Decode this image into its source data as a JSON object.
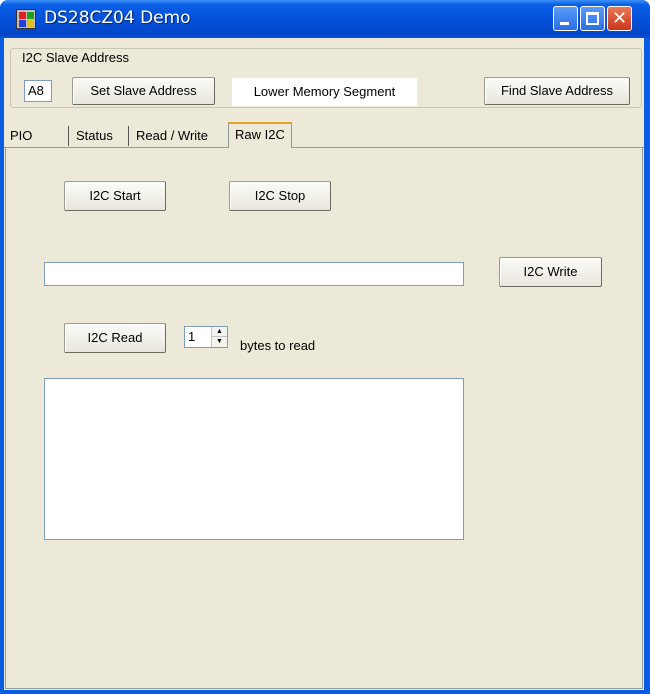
{
  "window": {
    "title": "DS28CZ04 Demo",
    "close_glyph": "✕"
  },
  "slave_address": {
    "group_label": "I2C Slave Address",
    "value": "A8",
    "set_button": "Set Slave Address",
    "segment_label": "Lower Memory Segment",
    "find_button": "Find Slave Address"
  },
  "tabs": [
    {
      "label": "PIO"
    },
    {
      "label": "Status"
    },
    {
      "label": "Read / Write"
    },
    {
      "label": "Raw I2C",
      "active": true
    }
  ],
  "raw_i2c": {
    "start_button": "I2C Start",
    "stop_button": "I2C Stop",
    "write_value": "",
    "write_button": "I2C Write",
    "read_button": "I2C Read",
    "bytes_value": "1",
    "spin_up_glyph": "▲",
    "spin_down_glyph": "▼",
    "bytes_label": "bytes to read",
    "read_output": ""
  },
  "colors": {
    "titlebar": "#0450d8",
    "face": "#ece9d8",
    "active_tab_accent": "#e6a225",
    "close_button": "#c9361a"
  }
}
